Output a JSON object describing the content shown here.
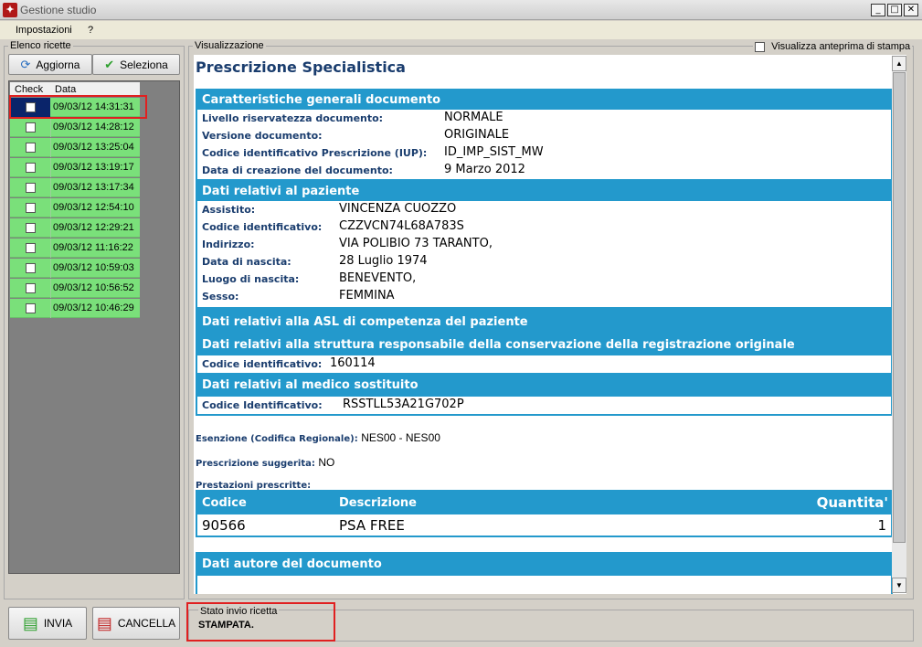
{
  "window": {
    "title": "Gestione studio",
    "icon_text": "✦"
  },
  "menu": {
    "items": [
      "Impostazioni",
      "?"
    ]
  },
  "left_panel": {
    "title": "Elenco ricette",
    "aggiorna_label": "Aggiorna",
    "seleziona_label": "Seleziona",
    "columns": [
      "Check",
      "Data"
    ],
    "rows": [
      "09/03/12 14:31:31",
      "09/03/12 14:28:12",
      "09/03/12 13:25:04",
      "09/03/12 13:19:17",
      "09/03/12 13:17:34",
      "09/03/12 12:54:10",
      "09/03/12 12:29:21",
      "09/03/12 11:16:22",
      "09/03/12 10:59:03",
      "09/03/12 10:56:52",
      "09/03/12 10:46:29"
    ],
    "invia_label": "INVIA",
    "cancella_label": "CANCELLA"
  },
  "viewer": {
    "title": "Visualizzazione",
    "preview_label": "Visualizza anteprima di stampa",
    "doc_title": "Prescrizione Specialistica",
    "sec1": {
      "head": "Caratteristiche generali documento",
      "k1": "Livello riservatezza documento:",
      "v1": "NORMALE",
      "k2": "Versione documento:",
      "v2": "ORIGINALE",
      "k3": "Codice identificativo Prescrizione (IUP):",
      "v3": "ID_IMP_SIST_MW",
      "k4": "Data di creazione del documento:",
      "v4": "9 Marzo 2012"
    },
    "sec2": {
      "head": "Dati relativi al paziente",
      "k1": "Assistito:",
      "v1": "VINCENZA CUOZZO",
      "k2": "Codice identificativo:",
      "v2": "CZZVCN74L68A783S",
      "k3": "Indirizzo:",
      "v3": "VIA POLIBIO 73 TARANTO,",
      "k4": "Data di nascita:",
      "v4": "28 Luglio 1974",
      "k5": "Luogo di nascita:",
      "v5": "BENEVENTO,",
      "k6": "Sesso:",
      "v6": "FEMMINA"
    },
    "sec3": {
      "head": "Dati relativi alla ASL di competenza del paziente",
      "head2": "Dati relativi alla struttura responsabile della conservazione della registrazione originale",
      "k1": "Codice identificativo:",
      "v1": "160114"
    },
    "sec4": {
      "head": "Dati relativi al medico sostituito",
      "k1": "Codice Identificativo:",
      "v1": "RSSTLL53A21G702P"
    },
    "esenzione_label": "Esenzione (Codifica Regionale):",
    "esenzione_value": "NES00 - NES00",
    "suggerita_label": "Prescrizione suggerita:",
    "suggerita_value": "NO",
    "prestazioni_label": "Prestazioni prescritte:",
    "table": {
      "col_codice": "Codice",
      "col_descrizione": "Descrizione",
      "col_quantita": "Quantita'",
      "codice": "90566",
      "descrizione": "PSA FREE",
      "quantita": "1"
    },
    "autore_head": "Dati autore del documento"
  },
  "status": {
    "title": "Stato invio ricetta",
    "value": "STAMPATA."
  },
  "colors": {
    "accent": "#2399cc",
    "row_green": "#7ae07a",
    "highlight_red": "#e02020",
    "dark_blue": "#1a3d6e"
  }
}
